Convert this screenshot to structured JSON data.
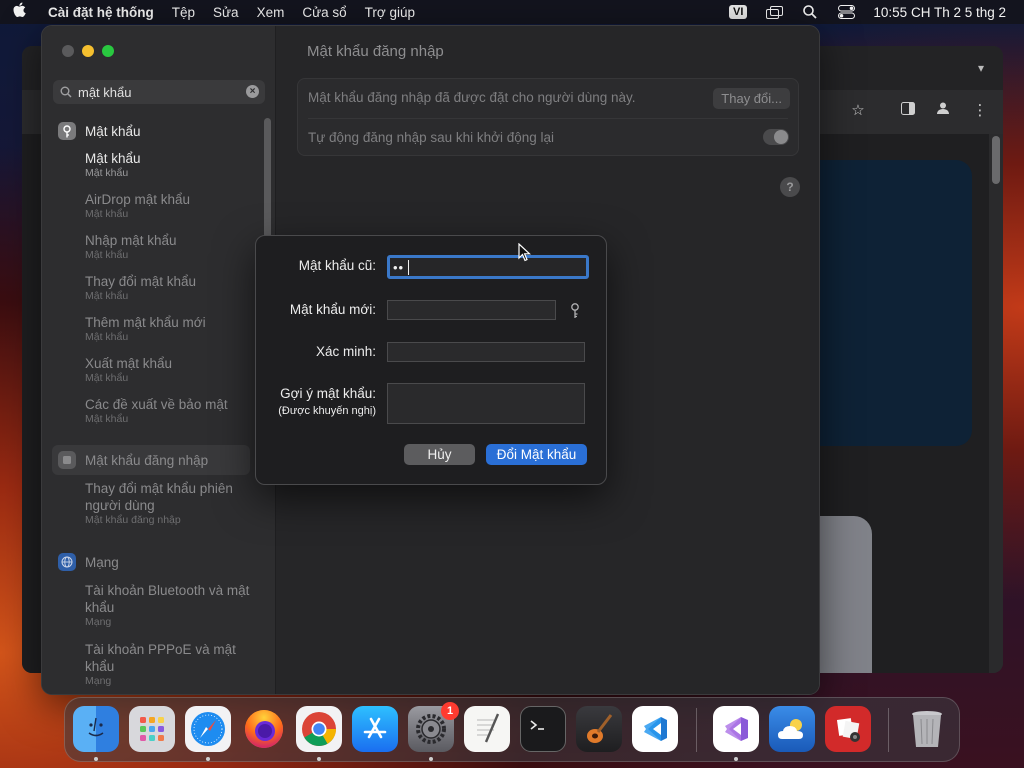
{
  "menubar": {
    "app_name": "Cài đặt hệ thống",
    "items": [
      "Tệp",
      "Sửa",
      "Xem",
      "Cửa sổ",
      "Trợ giúp"
    ],
    "input_source": "VI",
    "clock": "10:55 CH Th 2 5 thg 2"
  },
  "sidebar": {
    "search_value": "mật khẩu",
    "categories": [
      {
        "label": "Mật khẩu",
        "icon": "key-icon",
        "subitems": [
          {
            "title": "Mật khẩu",
            "subtitle": "Mật khẩu"
          },
          {
            "title": "AirDrop mật khẩu",
            "subtitle": "Mật khẩu"
          },
          {
            "title": "Nhập mật khẩu",
            "subtitle": "Mật khẩu"
          },
          {
            "title": "Thay đổi mật khẩu",
            "subtitle": "Mật khẩu"
          },
          {
            "title": "Thêm mật khẩu mới",
            "subtitle": "Mật khẩu"
          },
          {
            "title": "Xuất mật khẩu",
            "subtitle": "Mật khẩu"
          },
          {
            "title": "Các đề xuất về bảo mật",
            "subtitle": "Mật khẩu"
          }
        ]
      },
      {
        "label": "Mật khẩu đăng nhập",
        "icon": "login-password-icon",
        "subitems": [
          {
            "title": "Thay đổi mật khẩu phiên người dùng",
            "subtitle": "Mật khẩu đăng nhập"
          }
        ]
      },
      {
        "label": "Mạng",
        "icon": "network-globe-icon",
        "subitems": [
          {
            "title": "Tài khoản Bluetooth và mật khẩu",
            "subtitle": "Mạng"
          },
          {
            "title": "Tài khoản PPPoE và mật khẩu",
            "subtitle": "Mạng"
          }
        ]
      }
    ]
  },
  "main": {
    "title": "Mật khẩu đăng nhập",
    "row1_text": "Mật khẩu đăng nhập đã được đặt cho người dùng này.",
    "change_button": "Thay đổi...",
    "row2_text": "Tự động đăng nhập sau khi khởi động lại",
    "help_label": "?"
  },
  "dialog": {
    "old_password_label": "Mật khẩu cũ:",
    "old_password_value": "••",
    "new_password_label": "Mật khẩu mới:",
    "verify_label": "Xác minh:",
    "hint_label": "Gợi ý mật khẩu:",
    "hint_note": "(Được khuyến nghị)",
    "cancel_button": "Hủy",
    "confirm_button": "Đổi Mật khẩu"
  },
  "dock": {
    "settings_badge": "1",
    "apps": [
      "Finder",
      "Launchpad",
      "Safari",
      "Firefox",
      "Chrome",
      "App Store",
      "Cài đặt hệ thống",
      "TextEdit",
      "Terminal",
      "GarageBand",
      "Visual Studio Code",
      "Visual Studio",
      "Weather",
      "Photo Booth",
      "Thùng rác"
    ]
  },
  "colors": {
    "accent": "#2a6fd6",
    "focus_ring": "#3a78c9",
    "window_bg": "#262628",
    "sidebar_bg": "#2d2d2f"
  }
}
